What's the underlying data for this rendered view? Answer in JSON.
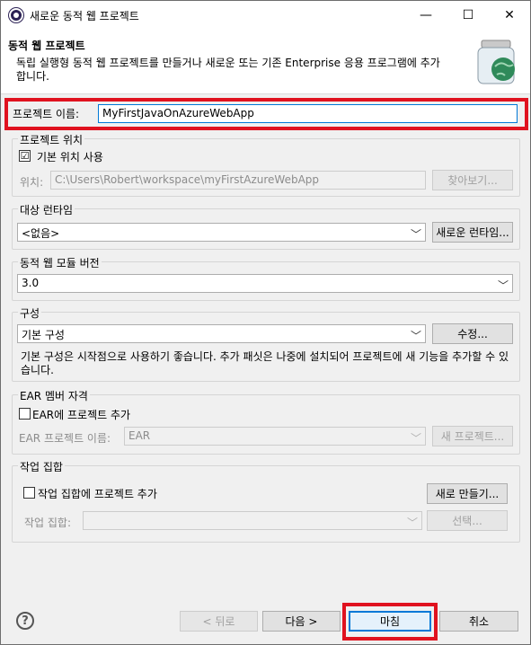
{
  "window": {
    "title": "새로운 동적 웹 프로젝트",
    "minimize": "—",
    "maximize": "☐",
    "close": "✕"
  },
  "header": {
    "title": "동적 웹 프로젝트",
    "description": "독립 실행형 동적 웹 프로젝트를 만들거나 새로운 또는 기존 Enterprise 응용 프로그램에 추가합니다."
  },
  "project_name": {
    "label": "프로젝트 이름:",
    "value": "MyFirstJavaOnAzureWebApp"
  },
  "location": {
    "group_title": "프로젝트 위치",
    "use_default_label": "기본 위치 사용",
    "use_default_checked": "☑",
    "location_label": "위치:",
    "location_value": "C:\\Users\\Robert\\workspace\\myFirstAzureWebApp",
    "browse_label": "찾아보기..."
  },
  "target_runtime": {
    "group_title": "대상 런타임",
    "selected": "<없음>",
    "new_runtime_label": "새로운 런타임..."
  },
  "module_version": {
    "group_title": "동적 웹 모듈 버전",
    "selected": "3.0"
  },
  "configuration": {
    "group_title": "구성",
    "selected": "기본 구성",
    "modify_label": "수정...",
    "description": "기본 구성은 시작점으로 사용하기 좋습니다. 추가 패싯은 나중에 설치되어 프로젝트에 새 기능을 추가할 수 있습니다."
  },
  "ear": {
    "group_title": "EAR 멤버 자격",
    "add_label": "EAR에 프로젝트 추가",
    "project_name_label": "EAR 프로젝트 이름:",
    "project_name_value": "EAR",
    "new_project_label": "새 프로젝트..."
  },
  "working_sets": {
    "group_title": "작업 집합",
    "add_label": "작업 집합에 프로젝트 추가",
    "new_label": "새로 만들기...",
    "sets_label": "작업 집합:",
    "select_label": "선택..."
  },
  "footer": {
    "help": "?",
    "back": "< 뒤로",
    "next": "다음 >",
    "finish": "마침",
    "cancel": "취소"
  },
  "colors": {
    "highlight": "#e0121f",
    "focus": "#0078d7"
  }
}
